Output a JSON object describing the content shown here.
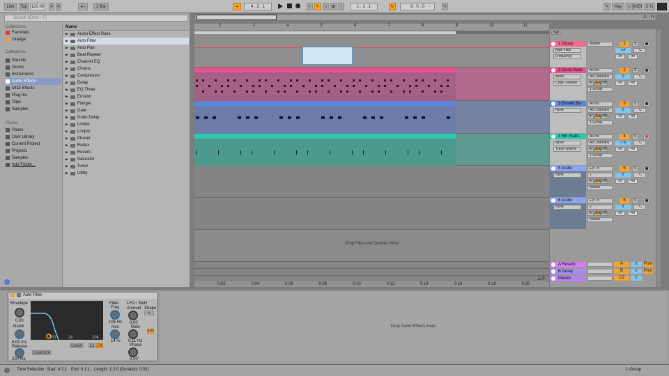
{
  "transport": {
    "link": "Link",
    "tap": "Tap",
    "tempo": "120.00",
    "sig_num": "4",
    "sig_den": "4",
    "metro": "●○",
    "quant": "1 Bar",
    "position": "4 . 3 . 1",
    "loop_start": "1 . 1 . 1",
    "loop_len": "8 . 0 . 0",
    "key": "Key",
    "midi": "MIDI",
    "cpu": "2 %",
    "d_btn": "D",
    "w_btn": "W"
  },
  "browser": {
    "search_placeholder": "Search (Cmd + F)",
    "collections_title": "Collections",
    "collections": [
      "Favorites",
      "Orange"
    ],
    "categories_title": "Categories",
    "categories": [
      "Sounds",
      "Drums",
      "Instruments",
      "Audio Effects",
      "MIDI Effects",
      "Plug-Ins",
      "Clips",
      "Samples"
    ],
    "places_title": "Places",
    "places": [
      "Packs",
      "User Library",
      "Current Project",
      "Projects",
      "Samples",
      "Add Folder..."
    ],
    "name_header": "Name",
    "items": [
      "Audio Effect Rack",
      "Auto Filter",
      "Auto Pan",
      "Beat Repeat",
      "Channel EQ",
      "Chorus",
      "Compressor",
      "Delay",
      "EQ Three",
      "Erosion",
      "Flanger",
      "Gate",
      "Grain Delay",
      "Limiter",
      "Looper",
      "Phaser",
      "Redux",
      "Reverb",
      "Saturator",
      "Tuner",
      "Utility"
    ]
  },
  "arrangement": {
    "ruler": [
      "2",
      "3",
      "4",
      "5",
      "6",
      "7",
      "8",
      "9",
      "10",
      "11"
    ],
    "times": [
      "0:02",
      "0:04",
      "0:06",
      "0:08",
      "0:10",
      "0:12",
      "0:14",
      "0:16",
      "0:18",
      "0:20"
    ],
    "drop_text": "Drop Files and Devices Here",
    "zoom": "1/4",
    "set_label": "Set"
  },
  "tracks": [
    {
      "name": "1 Group",
      "color": "#f26a8c",
      "io1": "Master",
      "dev": "Auto Filter",
      "param": "Frequency",
      "num": "1",
      "vol": "-inf",
      "pan": "C",
      "send": "-inf"
    },
    {
      "name": "2 Drum Rack",
      "color": "#e8508f",
      "io1": "All Ins",
      "io2": "All Channels",
      "io3": "1-Group",
      "dev": "Mixer",
      "param": "Chain Volume",
      "num": "2",
      "vol": "0",
      "pan": "C",
      "send": "-inf"
    },
    {
      "name": "3 Eleven Ba",
      "color": "#5e86d6",
      "io1": "All Ins",
      "io2": "All Channels",
      "io3": "1-Group",
      "dev": "None",
      "num": "3",
      "vol": "0",
      "pan": "C",
      "send": "-inf"
    },
    {
      "name": "4 5th Stab L",
      "color": "#2fc9b1",
      "io1": "All Ins",
      "io2": "All Channels",
      "io3": "1-Group",
      "dev": "Mixer",
      "param": "Track Volume",
      "num": "4",
      "vol": "-7.6",
      "pan": "C",
      "send": "-inf"
    },
    {
      "name": "5 Audio",
      "color": "#8aa4f2",
      "io1": "Ext. In",
      "io2": "1",
      "io3": "Master",
      "dev": "None",
      "num": "5",
      "vol": "0",
      "pan": "C",
      "send": "-inf"
    },
    {
      "name": "6 Audio",
      "color": "#8aa4f2",
      "io1": "Ext. In",
      "io2": "2",
      "io3": "Master",
      "dev": "None",
      "num": "6",
      "vol": "0",
      "pan": "C",
      "send": "-inf"
    }
  ],
  "returns": [
    {
      "name": "A Reverb",
      "color": "#d47cf0",
      "num": "A",
      "vol": "0",
      "post": "Post"
    },
    {
      "name": "B Delay",
      "color": "#a58bf0",
      "num": "B",
      "vol": "0",
      "post": "Post"
    },
    {
      "name": "Master",
      "color": "#b77ef0",
      "num": "1/2",
      "vol": "0"
    }
  ],
  "monitor": {
    "in": "In",
    "auto": "Auto",
    "off": "Off",
    "s": "S"
  },
  "device": {
    "title": "Auto Filter",
    "envelope": "Envelope",
    "env_val": "0.00",
    "attack": "Attack",
    "attack_val": "6.00 ms",
    "release": "Release",
    "release_val": "200 ms",
    "filter": "Filter",
    "freq": "Freq",
    "freq_val": "106 Hz",
    "res": "Res",
    "res_val": "14 %",
    "lfo": "LFO / S&H",
    "amount": "Amount",
    "amount_val": "0.00",
    "shape": "Shape",
    "rate": "Rate",
    "rate_val": "0.11 Hz",
    "phase": "Phase",
    "phase_val": "0.00°",
    "quantize": "Quantize",
    "hz": "Hz",
    "drop_text": "Drop Audio Effects Here",
    "axis": [
      "100",
      "1k",
      "10k"
    ],
    "db": [
      "12",
      "24"
    ],
    "clean": "Clean"
  },
  "status": {
    "sel": "Time Selection",
    "start": "Start: 4.3.1",
    "end": "End: 6.1.1",
    "length": "Length: 1.2.0 (Duration: 0:03)",
    "group": "1-Group"
  }
}
